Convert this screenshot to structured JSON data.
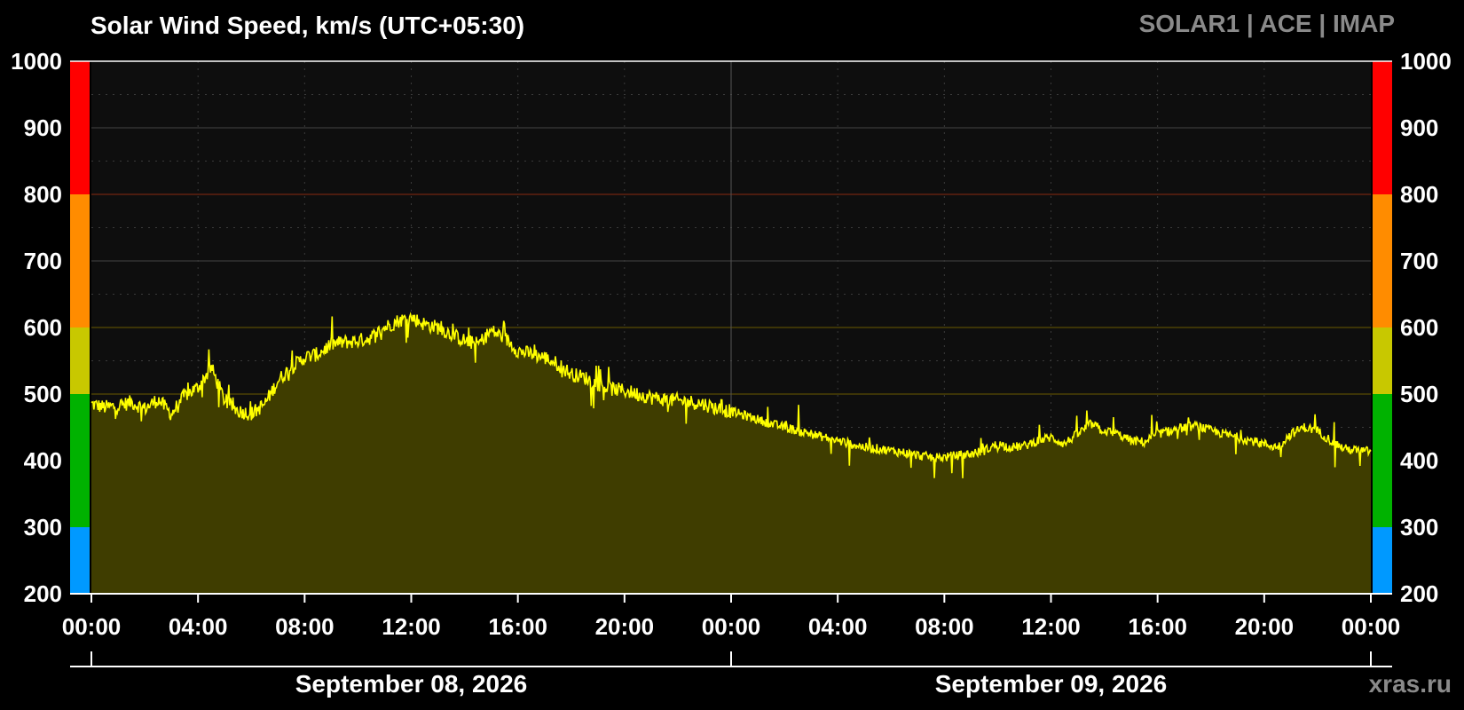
{
  "header": {
    "title": "Solar Wind Speed, km/s (UTC+05:30)",
    "sources": "SOLAR1 | ACE | IMAP",
    "watermark": "xras.ru"
  },
  "colors": {
    "background": "#000000",
    "plot_background": "#0e0e0e",
    "line": "#ffff00",
    "fill": "#3f3d00",
    "band_blue": "#0099ff",
    "band_green": "#00b200",
    "band_yellow": "#c8c800",
    "band_orange": "#ff8c00",
    "band_red": "#ff0000"
  },
  "chart_data": {
    "type": "area",
    "title": "Solar Wind Speed, km/s (UTC+05:30)",
    "ylabel": "",
    "xlabel": "",
    "ylim": [
      200,
      1000
    ],
    "yticks": [
      "1000",
      "900",
      "800",
      "700",
      "600",
      "500",
      "400",
      "300",
      "200"
    ],
    "xlim_hours": [
      0,
      48
    ],
    "xticks": [
      "00:00",
      "04:00",
      "08:00",
      "12:00",
      "16:00",
      "20:00",
      "00:00",
      "04:00",
      "08:00",
      "12:00",
      "16:00",
      "20:00",
      "00:00"
    ],
    "dates": [
      "September 08, 2026",
      "September 09, 2026"
    ],
    "thresholds": [
      500,
      600,
      800
    ],
    "bands": [
      {
        "from": 200,
        "to": 300,
        "color": "#0099ff"
      },
      {
        "from": 300,
        "to": 500,
        "color": "#00b200"
      },
      {
        "from": 500,
        "to": 600,
        "color": "#c8c800"
      },
      {
        "from": 600,
        "to": 800,
        "color": "#ff8c00"
      },
      {
        "from": 800,
        "to": 1000,
        "color": "#ff0000"
      }
    ],
    "series": [
      {
        "x_hours": [
          0,
          0.5,
          1,
          1.5,
          2,
          2.5,
          3,
          3.5,
          4,
          4.5,
          5,
          5.5,
          6,
          6.5,
          7,
          7.5,
          8,
          8.5,
          9,
          9.5,
          10,
          10.5,
          11,
          11.5,
          12,
          12.5,
          13,
          13.5,
          14,
          14.5,
          15,
          15.5,
          16,
          16.5,
          17,
          17.5,
          18,
          18.5,
          19,
          19.5,
          20,
          20.5,
          21,
          21.5,
          22,
          22.5,
          23,
          23.5,
          24,
          24.5,
          25,
          25.5,
          26,
          26.5,
          27,
          27.5,
          28,
          28.5,
          29,
          29.5,
          30,
          30.5,
          31,
          31.5,
          32,
          32.5,
          33,
          33.5,
          34,
          34.5,
          35,
          35.5,
          36,
          36.5,
          37,
          37.5,
          38,
          38.5,
          39,
          39.5,
          40,
          40.5,
          41,
          41.5,
          42,
          42.5,
          43,
          43.5,
          44,
          44.5,
          45,
          45.5,
          46,
          46.5,
          47,
          47.5,
          48
        ],
        "values": [
          485,
          480,
          482,
          488,
          478,
          492,
          470,
          498,
          510,
          540,
          490,
          475,
          470,
          485,
          520,
          540,
          555,
          560,
          575,
          578,
          580,
          585,
          600,
          610,
          615,
          605,
          600,
          590,
          580,
          575,
          595,
          585,
          565,
          560,
          555,
          545,
          530,
          525,
          515,
          508,
          505,
          500,
          495,
          492,
          490,
          488,
          485,
          478,
          474,
          468,
          462,
          455,
          450,
          445,
          440,
          435,
          430,
          425,
          420,
          418,
          415,
          412,
          408,
          405,
          405,
          408,
          410,
          415,
          425,
          420,
          422,
          430,
          435,
          425,
          440,
          455,
          445,
          440,
          430,
          428,
          440,
          445,
          450,
          452,
          445,
          440,
          435,
          430,
          425,
          420,
          440,
          450,
          445,
          430,
          418,
          415,
          414
        ]
      }
    ]
  }
}
